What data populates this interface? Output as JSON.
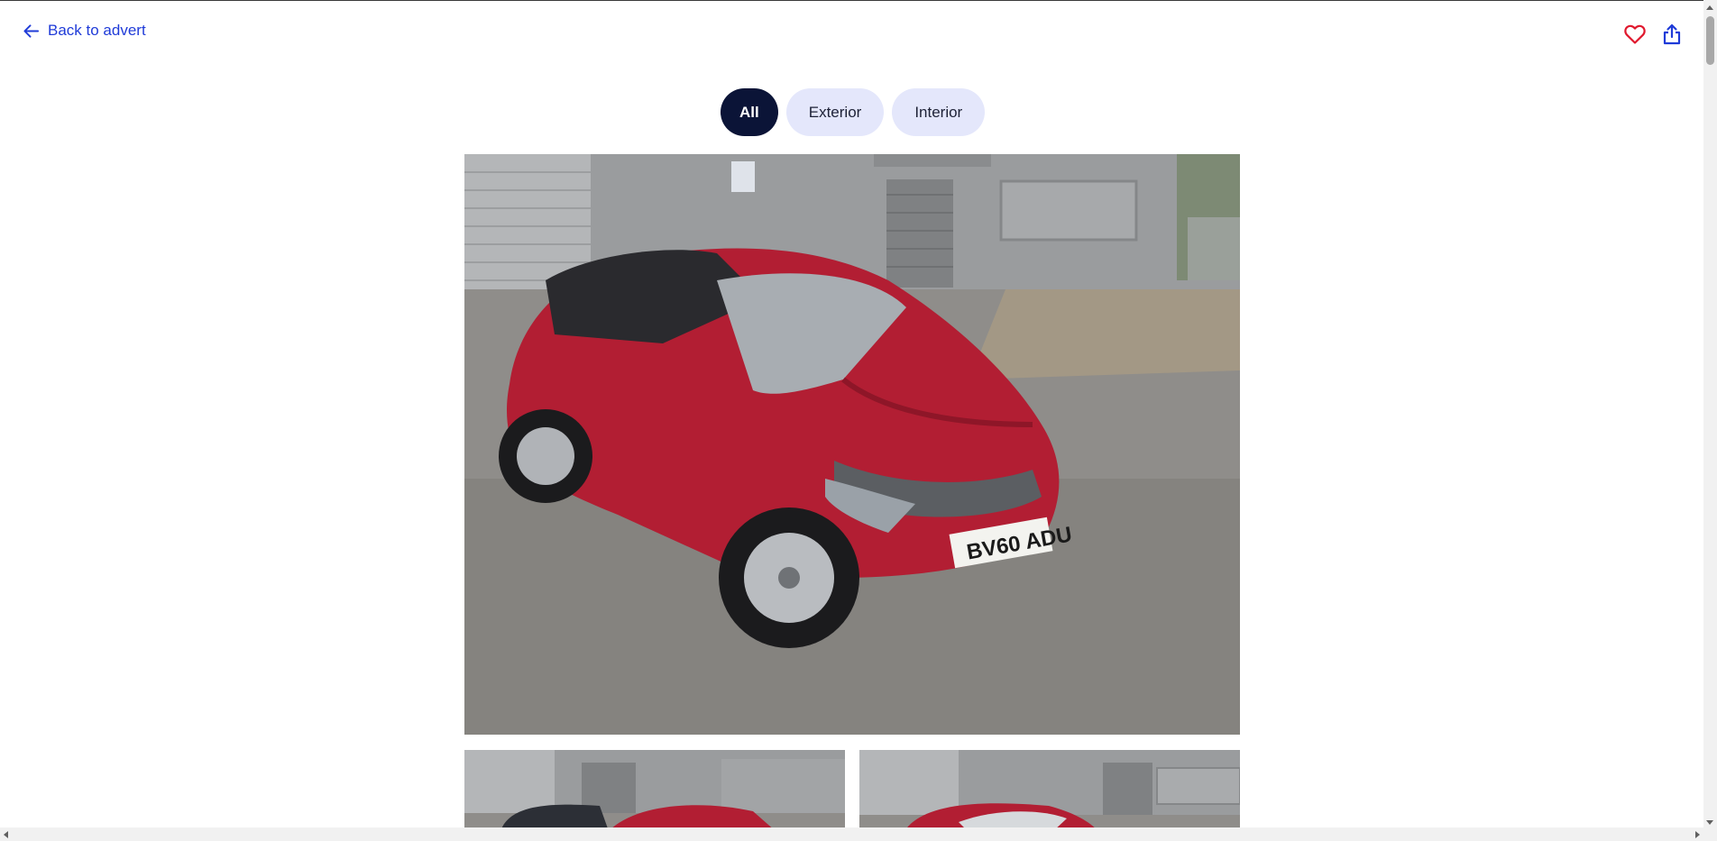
{
  "header": {
    "back_label": "Back to advert",
    "back_icon": "arrow-left-icon",
    "favourite_icon": "heart-icon",
    "share_icon": "share-icon",
    "accent_color": "#1f3bd8",
    "favourite_color": "#e0182d"
  },
  "filters": {
    "items": [
      {
        "label": "All",
        "active": true
      },
      {
        "label": "Exterior",
        "active": false
      },
      {
        "label": "Interior",
        "active": false
      }
    ]
  },
  "gallery": {
    "main_photo": {
      "plate": "BV60 ADU"
    },
    "thumbnail_count_visible": 2
  }
}
